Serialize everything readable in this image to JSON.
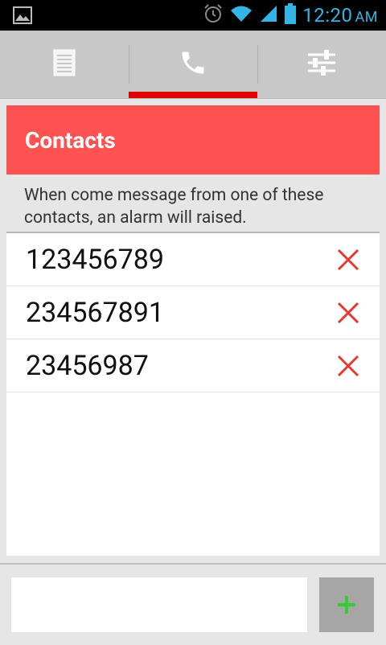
{
  "status_bar": {
    "time": "12:20",
    "ampm": "AM",
    "icons": [
      "image-icon",
      "alarm-icon",
      "wifi-icon",
      "signal-icon",
      "battery-icon"
    ]
  },
  "tabs": [
    {
      "name": "messages",
      "icon": "document-icon",
      "active": false
    },
    {
      "name": "contacts",
      "icon": "phone-icon",
      "active": true
    },
    {
      "name": "settings",
      "icon": "sliders-icon",
      "active": false
    }
  ],
  "main": {
    "title": "Contacts",
    "description": "When come message from one of these contacts, an alarm will raised.",
    "contacts": [
      "123456789",
      "234567891",
      "23456987"
    ]
  },
  "add_bar": {
    "input_value": "",
    "add_icon": "plus-icon"
  },
  "colors": {
    "accent": "#ff5252",
    "tab_indicator": "#e10000",
    "delete": "#e53935",
    "add": "#33cc33",
    "status_text": "#33b5e5"
  }
}
